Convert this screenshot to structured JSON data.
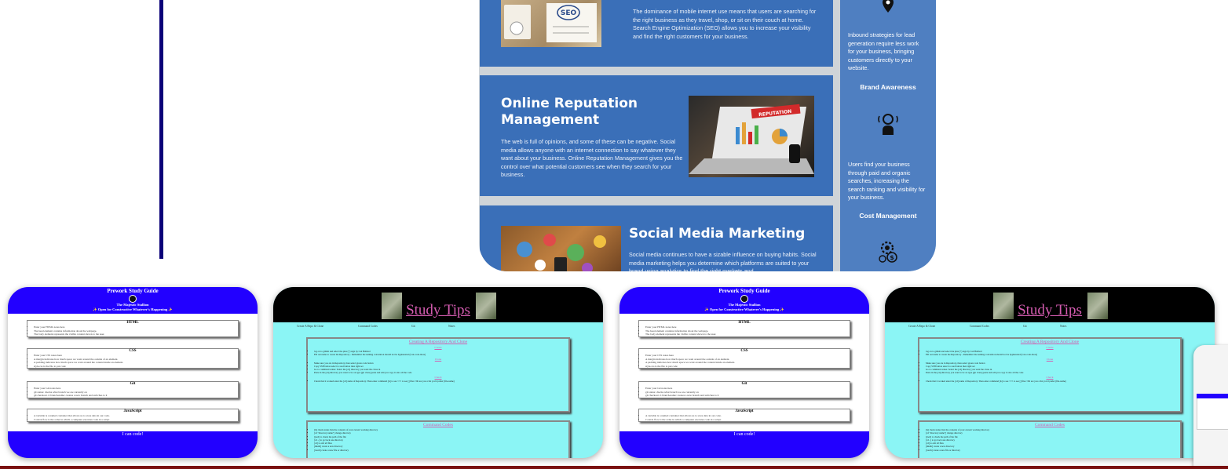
{
  "marketing": {
    "seo_text": "The dominance of mobile internet use means that users are searching for the right business as they travel, shop, or sit on their couch at home. Search Engine Optimization (SEO) allows you to increase your visibility and find the right customers for your business.",
    "seo_image_label": "SEO",
    "reputation_title": "Online Reputation Management",
    "reputation_text": "The web is full of opinions, and some of these can be negative. Social media allows anyone with an internet connection to say whatever they want about your business. Online Reputation Management gives you the control over what potential customers see when they search for your business.",
    "reputation_image_label": "REPUTATION",
    "social_title": "Social Media Marketing",
    "social_text": "Social media continues to have a sizable influence on buying habits. Social media marketing helps you determine which platforms are suited to your brand using analytics to find the right markets and",
    "sidebar": {
      "lead_text": "Inbound strategies for lead generation require less work for your business, bringing customers directly to your website.",
      "brand_heading": "Brand Awareness",
      "brand_text": "Users find your business through paid and organic searches, increasing the search ranking and visibility for your business.",
      "cost_heading": "Cost Management"
    },
    "colors": {
      "card": "#3a6fb8",
      "sidebar": "#4f7fc1"
    },
    "icons": [
      "location-pin-icon",
      "megaphone-person-icon",
      "gear-dollar-icon"
    ]
  },
  "prework": {
    "title": "Prework Study Guide",
    "name": "The Majestic Stallion",
    "tagline": "✨ Open for Constructive Whatever's Happening ✨",
    "sections": [
      {
        "heading": "HTML",
        "items": [
          "Enter your HTML notes here",
          "The head element contains information about the webpage.",
          "The body element represents the visible content shown to the user."
        ]
      },
      {
        "heading": "CSS",
        "items": [
          "Enter your CSS notes here",
          "A margin indicates how much space we want around the outside of an element.",
          "A padding indicates how much space we want around the content inside an element.",
          "style.css is the file to put code"
        ]
      },
      {
        "heading": "Git",
        "items": [
          "Enter your Git notes here",
          "git status: checks what branch we are currently on",
          "git checkout -b branch-name: creates a new branch and switches to it"
        ]
      },
      {
        "heading": "JavaScript",
        "items": [
          "A variable is a named container that allows us to store data in our code.",
          "Control flow is the order in which a computer executes code in a script."
        ]
      }
    ],
    "footer": "I can code!"
  },
  "study_tips": {
    "title": "Study Tips",
    "nav": [
      "Create A Repo & Clone",
      "Command Codes",
      "Git",
      "Notes"
    ],
    "box1": {
      "heading": "Creating A Repository And Clone",
      "sub1": "Create",
      "items1": [
        "log on to github and select the plus (+) sign by: Git Hubbed",
        "Fill out name to create the Repository - Remember the naming convention should not be hyphenated (Can-code-more)"
      ],
      "sub2": "Clone",
      "items2": [
        "Make sure you are in Repository, then select green code button",
        "Copy SSH button select to read button then right set",
        "Go to command center. Select the [cd] directory you want the clone in",
        "Paste in the [cd] directory you want to be on type [git clone] paste and add you copy it onto all the code"
      ],
      "sub3": "Check",
      "items3": [
        "Check that it worked enter the [cd] name of Repository. Then enter command [ls] to see <<< to see [] files <lib are you a list you'd prefer (file-name)"
      ]
    },
    "box2": {
      "heading": "Command Codes",
      "items": [
        "[ls] check status lists the contents of your current working directory",
        "[cd \"directory name\"] change directory",
        "[pwd] to check the path of the file",
        "[cd ..] to go back one directory",
        "[cd] to exit all files",
        "[mkdir] create a new directory",
        "[touch] create a new file or directory"
      ]
    }
  }
}
